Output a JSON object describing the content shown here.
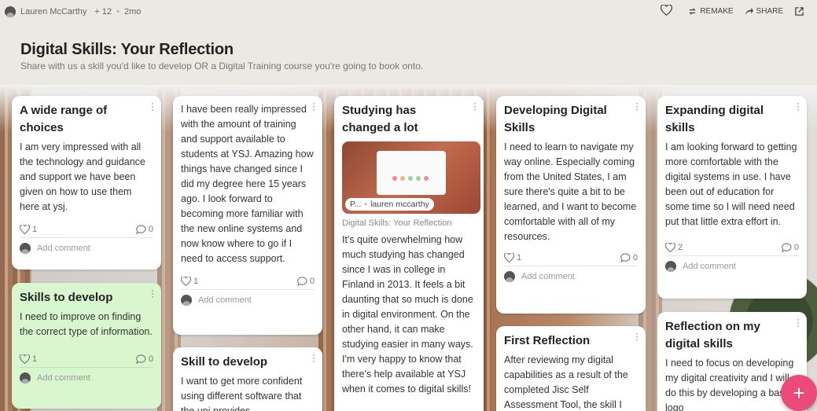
{
  "author": {
    "name": "Lauren McCarthy",
    "contributors": "+ 12",
    "age": "2mo"
  },
  "toolbar": {
    "remake_label": "REMAKE",
    "share_label": "SHARE"
  },
  "header": {
    "title": "Digital Skills: Your Reflection",
    "subtitle": "Share with us a skill you'd like to develop OR a Digital Training course you're going to book onto."
  },
  "add_comment_label": "Add comment",
  "cards": {
    "c1": {
      "title": "A wide range of choices",
      "body": "I am very impressed with all the technology and guidance and support we have been given on how to use them here at ysj.",
      "likes": "1",
      "comments": "0"
    },
    "c2": {
      "title": "Skills to develop",
      "body": "I need to improve on finding the correct type of information.",
      "likes": "1",
      "comments": "0"
    },
    "c3": {
      "title": "",
      "body": "I have been really impressed with the amount of training and support available to students at YSJ. Amazing how things have changed since I did my degree here 15 years ago. I look forward to becoming more familiar with the new online systems and now know where to go if I need to access support.",
      "likes": "1",
      "comments": "0"
    },
    "c4": {
      "title": "Skill to develop",
      "body": "I want to get more confident using different software that the uni provides."
    },
    "c5": {
      "title": "Studying has changed a lot",
      "attachment_short": "P...",
      "attachment_author": "lauren mccarthy",
      "attachment_label": "Digital Skills: Your Reflection",
      "body": "It's quite overwhelming how much studying has changed since I was in college in Finland in 2013. It feels a bit daunting that so much is done in digital environment. On the other hand, it can make studying easier in many ways. I'm very happy to know that there's help available at YSJ when it comes to digital skills!"
    },
    "c6": {
      "title": "Developing Digital Skills",
      "body": "I need to learn to navigate my way online. Especially coming from the United States, I am sure there's quite a bit to be learned, and I want to become comfortable with all of my resources.",
      "likes": "1",
      "comments": "0"
    },
    "c7": {
      "title": "First Reflection",
      "body": "After reviewing my digital capabilities as a result of the completed Jisc Self Assessment Tool, the skill I"
    },
    "c8": {
      "title": "Expanding digital skills",
      "body": "I am looking forward to getting more comfortable with the digital systems in use. I have been out of education for some time so I will need need put that little extra effort in.",
      "likes": "2",
      "comments": "0"
    },
    "c9": {
      "title": "Reflection on my digital skills",
      "body": "I need to focus on developing my digital creativity and I will do this by developing a basic logo"
    }
  },
  "colors": {
    "accent": "#ec4a7b",
    "green_card": "#d9f7cf"
  },
  "fab_label": "+"
}
